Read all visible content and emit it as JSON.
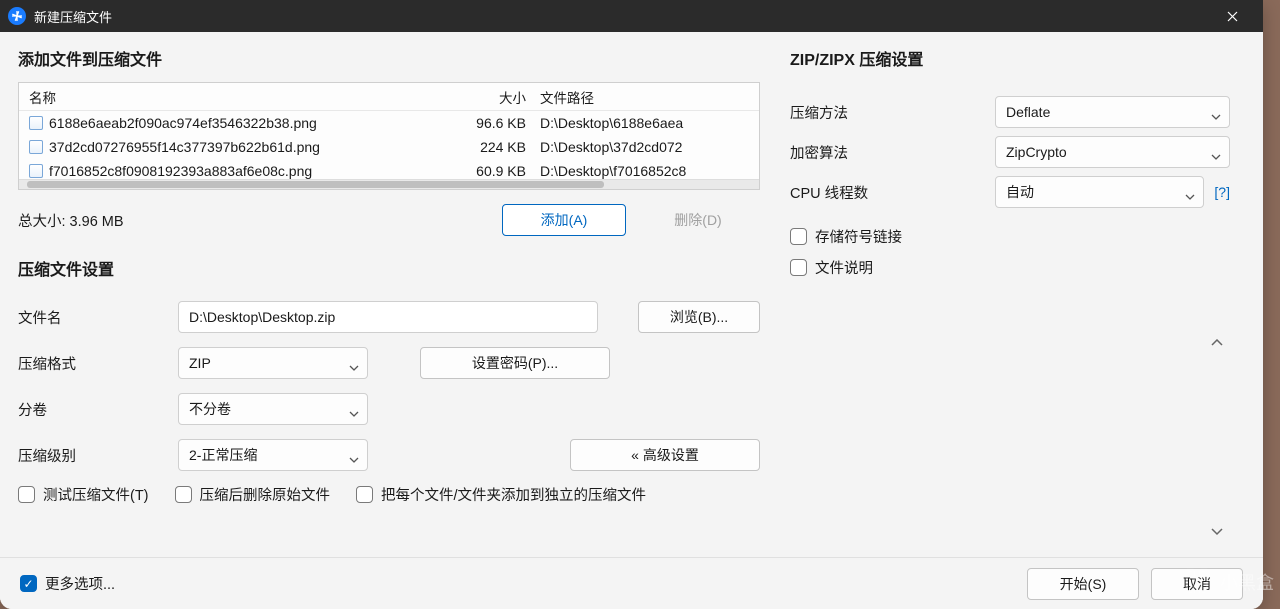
{
  "window": {
    "title": "新建压缩文件"
  },
  "left": {
    "add_title": "添加文件到压缩文件",
    "columns": {
      "name": "名称",
      "size": "大小",
      "path": "文件路径"
    },
    "files": [
      {
        "name": "6188e6aeab2f090ac974ef3546322b38.png",
        "size": "96.6 KB",
        "path": "D:\\Desktop\\6188e6aea"
      },
      {
        "name": "37d2cd07276955f14c377397b622b61d.png",
        "size": "224 KB",
        "path": "D:\\Desktop\\37d2cd072"
      },
      {
        "name": "f7016852c8f0908192393a883af6e08c.png",
        "size": "60.9 KB",
        "path": "D:\\Desktop\\f7016852c8"
      }
    ],
    "total_label": "总大小: 3.96 MB",
    "add_btn": "添加(A)",
    "delete_btn": "删除(D)",
    "settings_title": "压缩文件设置",
    "filename_label": "文件名",
    "filename_value": "D:\\Desktop\\Desktop.zip",
    "browse_btn": "浏览(B)...",
    "format_label": "压缩格式",
    "format_value": "ZIP",
    "password_btn": "设置密码(P)...",
    "split_label": "分卷",
    "split_value": "不分卷",
    "level_label": "压缩级别",
    "level_value": "2-正常压缩",
    "advanced_btn": "« 高级设置",
    "chk_test": "测试压缩文件(T)",
    "chk_delete_after": "压缩后删除原始文件",
    "chk_each_separate": "把每个文件/文件夹添加到独立的压缩文件"
  },
  "right": {
    "title": "ZIP/ZIPX 压缩设置",
    "method_label": "压缩方法",
    "method_value": "Deflate",
    "encrypt_label": "加密算法",
    "encrypt_value": "ZipCrypto",
    "threads_label": "CPU 线程数",
    "threads_value": "自动",
    "help": "[?]",
    "chk_symlink": "存储符号链接",
    "chk_comment": "文件说明"
  },
  "footer": {
    "more_options": "更多选项...",
    "start_btn": "开始(S)",
    "cancel_btn": "取消"
  },
  "watermark": "小黑盒"
}
